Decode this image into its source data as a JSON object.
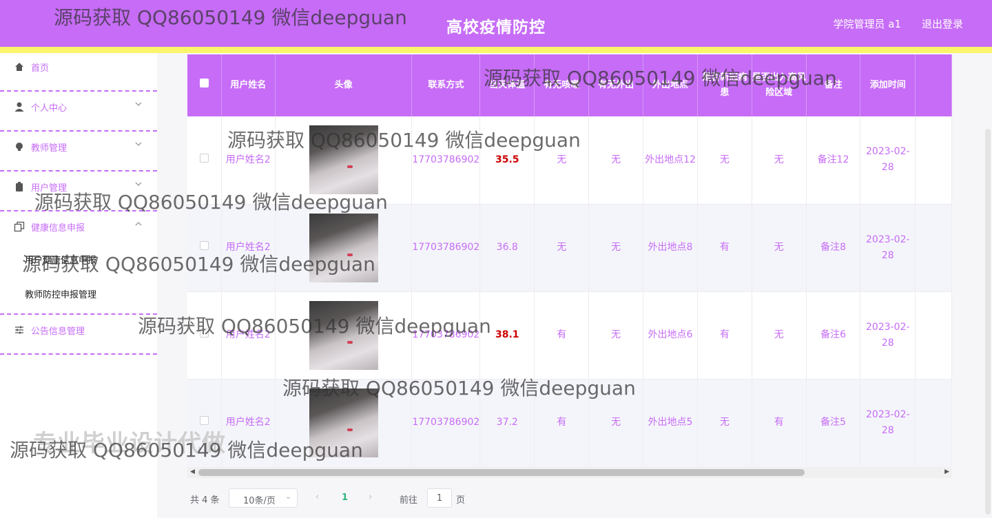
{
  "header": {
    "title": "高校疫情防控",
    "user": "学院管理员 a1",
    "logout": "退出登录"
  },
  "sidebar": {
    "items": [
      {
        "label": "首页",
        "icon": "home-icon"
      },
      {
        "label": "个人中心",
        "icon": "user-icon"
      },
      {
        "label": "教师管理",
        "icon": "bulb-icon"
      },
      {
        "label": "用户管理",
        "icon": "clipboard-icon"
      },
      {
        "label": "健康信息申报",
        "icon": "copy-icon"
      },
      {
        "label": "公告信息管理",
        "icon": "sliders-icon"
      }
    ],
    "sub_items": [
      {
        "label": "用户健康信息申报"
      },
      {
        "label": "教师防控申报管理"
      }
    ]
  },
  "table": {
    "headers": [
      "用户姓名",
      "头像",
      "联系方式",
      "当天体温",
      "有无咳嗽",
      "有无外出",
      "外出地点",
      "是否新冠病患",
      "是否出入高风险区域",
      "备注",
      "添加时间"
    ],
    "rows": [
      {
        "name": "用户姓名2",
        "phone": "17703786902",
        "temp": "35.5",
        "cough": "无",
        "out": "无",
        "place": "外出地点12",
        "covid": "无",
        "risk": "无",
        "note": "备注12",
        "time": "2023-02-28"
      },
      {
        "name": "用户姓名2",
        "phone": "17703786902",
        "temp": "36.8",
        "cough": "无",
        "out": "无",
        "place": "外出地点8",
        "covid": "有",
        "risk": "无",
        "note": "备注8",
        "time": "2023-02-28"
      },
      {
        "name": "用户姓名2",
        "phone": "17703786902",
        "temp": "38.1",
        "cough": "有",
        "out": "无",
        "place": "外出地点6",
        "covid": "有",
        "risk": "无",
        "note": "备注6",
        "time": "2023-02-28"
      },
      {
        "name": "用户姓名2",
        "phone": "17703786902",
        "temp": "37.2",
        "cough": "有",
        "out": "无",
        "place": "外出地点5",
        "covid": "无",
        "risk": "有",
        "note": "备注5",
        "time": "2023-02-28"
      }
    ]
  },
  "pager": {
    "total": "共 4 条",
    "size": "10条/页",
    "page": "1",
    "goto_prefix": "前往",
    "goto_value": "1",
    "goto_suffix": "页"
  },
  "watermarks": {
    "text": "源码获取 QQ86050149 微信deepguan",
    "big": "专业毕业设计代做"
  },
  "colors": {
    "accent": "#c66cf6",
    "stripe": "#fbf56b",
    "fever": "#cc0000",
    "page_active": "#2db77f"
  }
}
